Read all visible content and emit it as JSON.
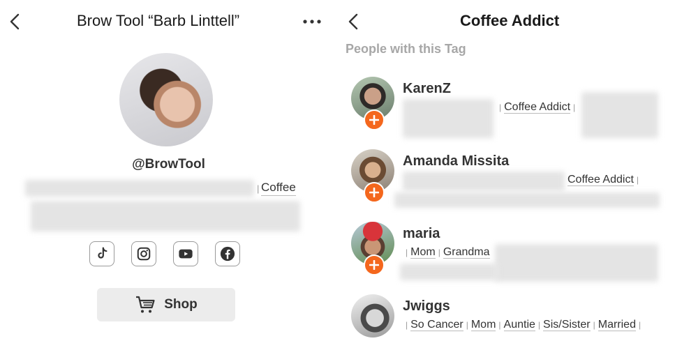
{
  "left": {
    "title": "Brow Tool “Barb Linttell”",
    "handle": "@BrowTool",
    "tag_visible": "Coffee",
    "socials": [
      {
        "icon": "tiktok-icon"
      },
      {
        "icon": "instagram-icon"
      },
      {
        "icon": "youtube-icon"
      },
      {
        "icon": "facebook-icon"
      }
    ],
    "shop_label": "Shop",
    "colors": {
      "accent": "#f4671d",
      "button_bg": "#ececec"
    }
  },
  "right": {
    "title": "Coffee Addict",
    "subheading": "People with this Tag",
    "people": [
      {
        "name": "KarenZ",
        "tags": [
          "Coffee Addict"
        ]
      },
      {
        "name": "Amanda Missita",
        "tags": [
          "Coffee Addict"
        ]
      },
      {
        "name": "maria",
        "tags": [
          "Mom",
          "Grandma"
        ]
      },
      {
        "name": "Jwiggs",
        "tags": [
          "So Cancer",
          "Mom",
          "Auntie",
          "Sis/Sister",
          "Married"
        ]
      }
    ]
  }
}
